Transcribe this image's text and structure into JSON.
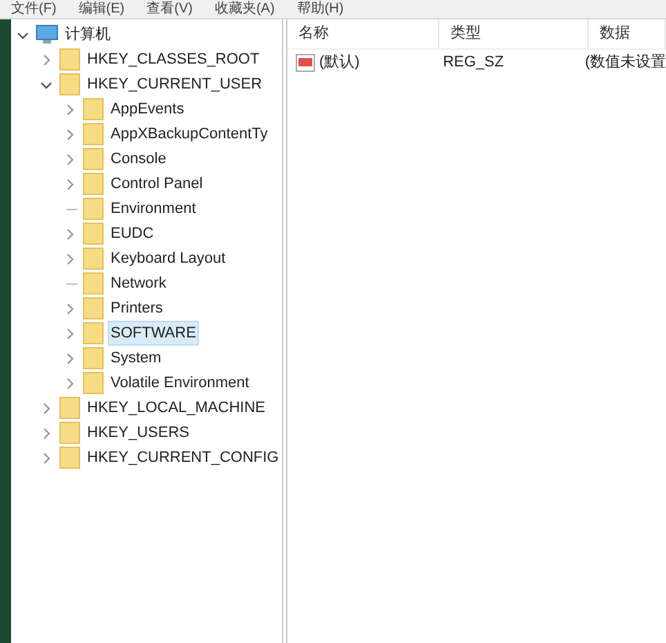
{
  "menu": [
    "文件(F)",
    "编辑(E)",
    "查看(V)",
    "收藏夹(A)",
    "帮助(H)"
  ],
  "tree": [
    {
      "label": "计算机",
      "kind": "computer",
      "expanded": true,
      "selected": false,
      "children": [
        {
          "label": "HKEY_CLASSES_ROOT",
          "kind": "branch",
          "expanded": false,
          "selected": false
        },
        {
          "label": "HKEY_CURRENT_USER",
          "kind": "branch",
          "expanded": true,
          "selected": false,
          "children": [
            {
              "label": "AppEvents",
              "kind": "branch",
              "expanded": false,
              "selected": false
            },
            {
              "label": "AppXBackupContentTy",
              "kind": "branch",
              "expanded": false,
              "selected": false
            },
            {
              "label": "Console",
              "kind": "branch",
              "expanded": false,
              "selected": false
            },
            {
              "label": "Control Panel",
              "kind": "branch",
              "expanded": false,
              "selected": false
            },
            {
              "label": "Environment",
              "kind": "leaf",
              "selected": false
            },
            {
              "label": "EUDC",
              "kind": "branch",
              "expanded": false,
              "selected": false
            },
            {
              "label": "Keyboard Layout",
              "kind": "branch",
              "expanded": false,
              "selected": false
            },
            {
              "label": "Network",
              "kind": "leaf",
              "selected": false
            },
            {
              "label": "Printers",
              "kind": "branch",
              "expanded": false,
              "selected": false
            },
            {
              "label": "SOFTWARE",
              "kind": "branch",
              "expanded": false,
              "selected": true
            },
            {
              "label": "System",
              "kind": "branch",
              "expanded": false,
              "selected": false
            },
            {
              "label": "Volatile Environment",
              "kind": "branch",
              "expanded": false,
              "selected": false
            }
          ]
        },
        {
          "label": "HKEY_LOCAL_MACHINE",
          "kind": "branch",
          "expanded": false,
          "selected": false
        },
        {
          "label": "HKEY_USERS",
          "kind": "branch",
          "expanded": false,
          "selected": false
        },
        {
          "label": "HKEY_CURRENT_CONFIG",
          "kind": "branch",
          "expanded": false,
          "selected": false
        }
      ]
    }
  ],
  "table": {
    "columns": [
      "名称",
      "类型",
      "数据"
    ],
    "rows": [
      {
        "name": "(默认)",
        "type": "REG_SZ",
        "data": "(数值未设置"
      }
    ]
  }
}
